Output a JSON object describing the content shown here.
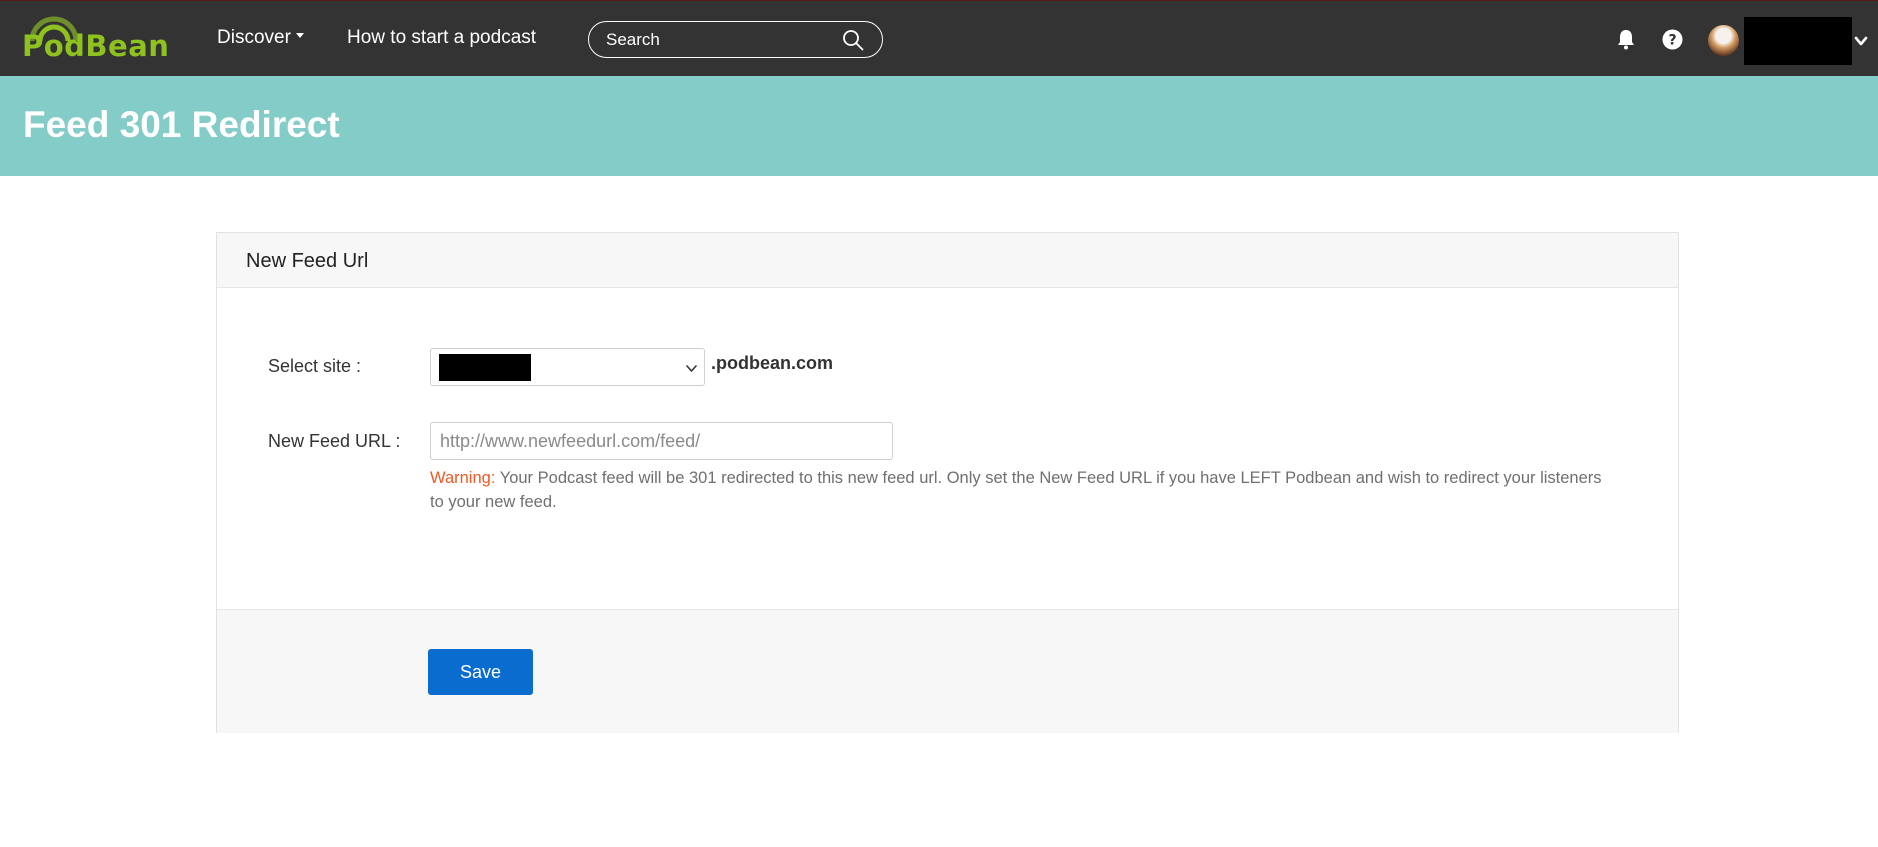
{
  "brand": {
    "logo_text": "PodBean",
    "accent_color": "#8dc21f"
  },
  "nav": {
    "discover_label": "Discover",
    "howto_label": "How to start a podcast",
    "search_placeholder": "Search"
  },
  "header_icons": [
    "bell-icon",
    "help-icon",
    "avatar",
    "chevron-down-icon"
  ],
  "account": {
    "user_name": ""
  },
  "page": {
    "title": "Feed 301 Redirect",
    "band_color": "#83ccc7"
  },
  "panel": {
    "title": "New Feed Url",
    "select_site_label": "Select site :",
    "selected_site": "",
    "domain_suffix": ".podbean.com",
    "new_feed_label": "New Feed URL :",
    "new_feed_placeholder": "http://www.newfeedurl.com/feed/",
    "new_feed_value": "",
    "warning_label": "Warning:",
    "warning_text": " Your Podcast feed will be 301 redirected to this new feed url. Only set the New Feed URL if you have LEFT Podbean and wish to redirect your listeners to your new feed.",
    "warning_color": "#ee5a24",
    "save_label": "Save",
    "save_color": "#0a6ccf"
  }
}
